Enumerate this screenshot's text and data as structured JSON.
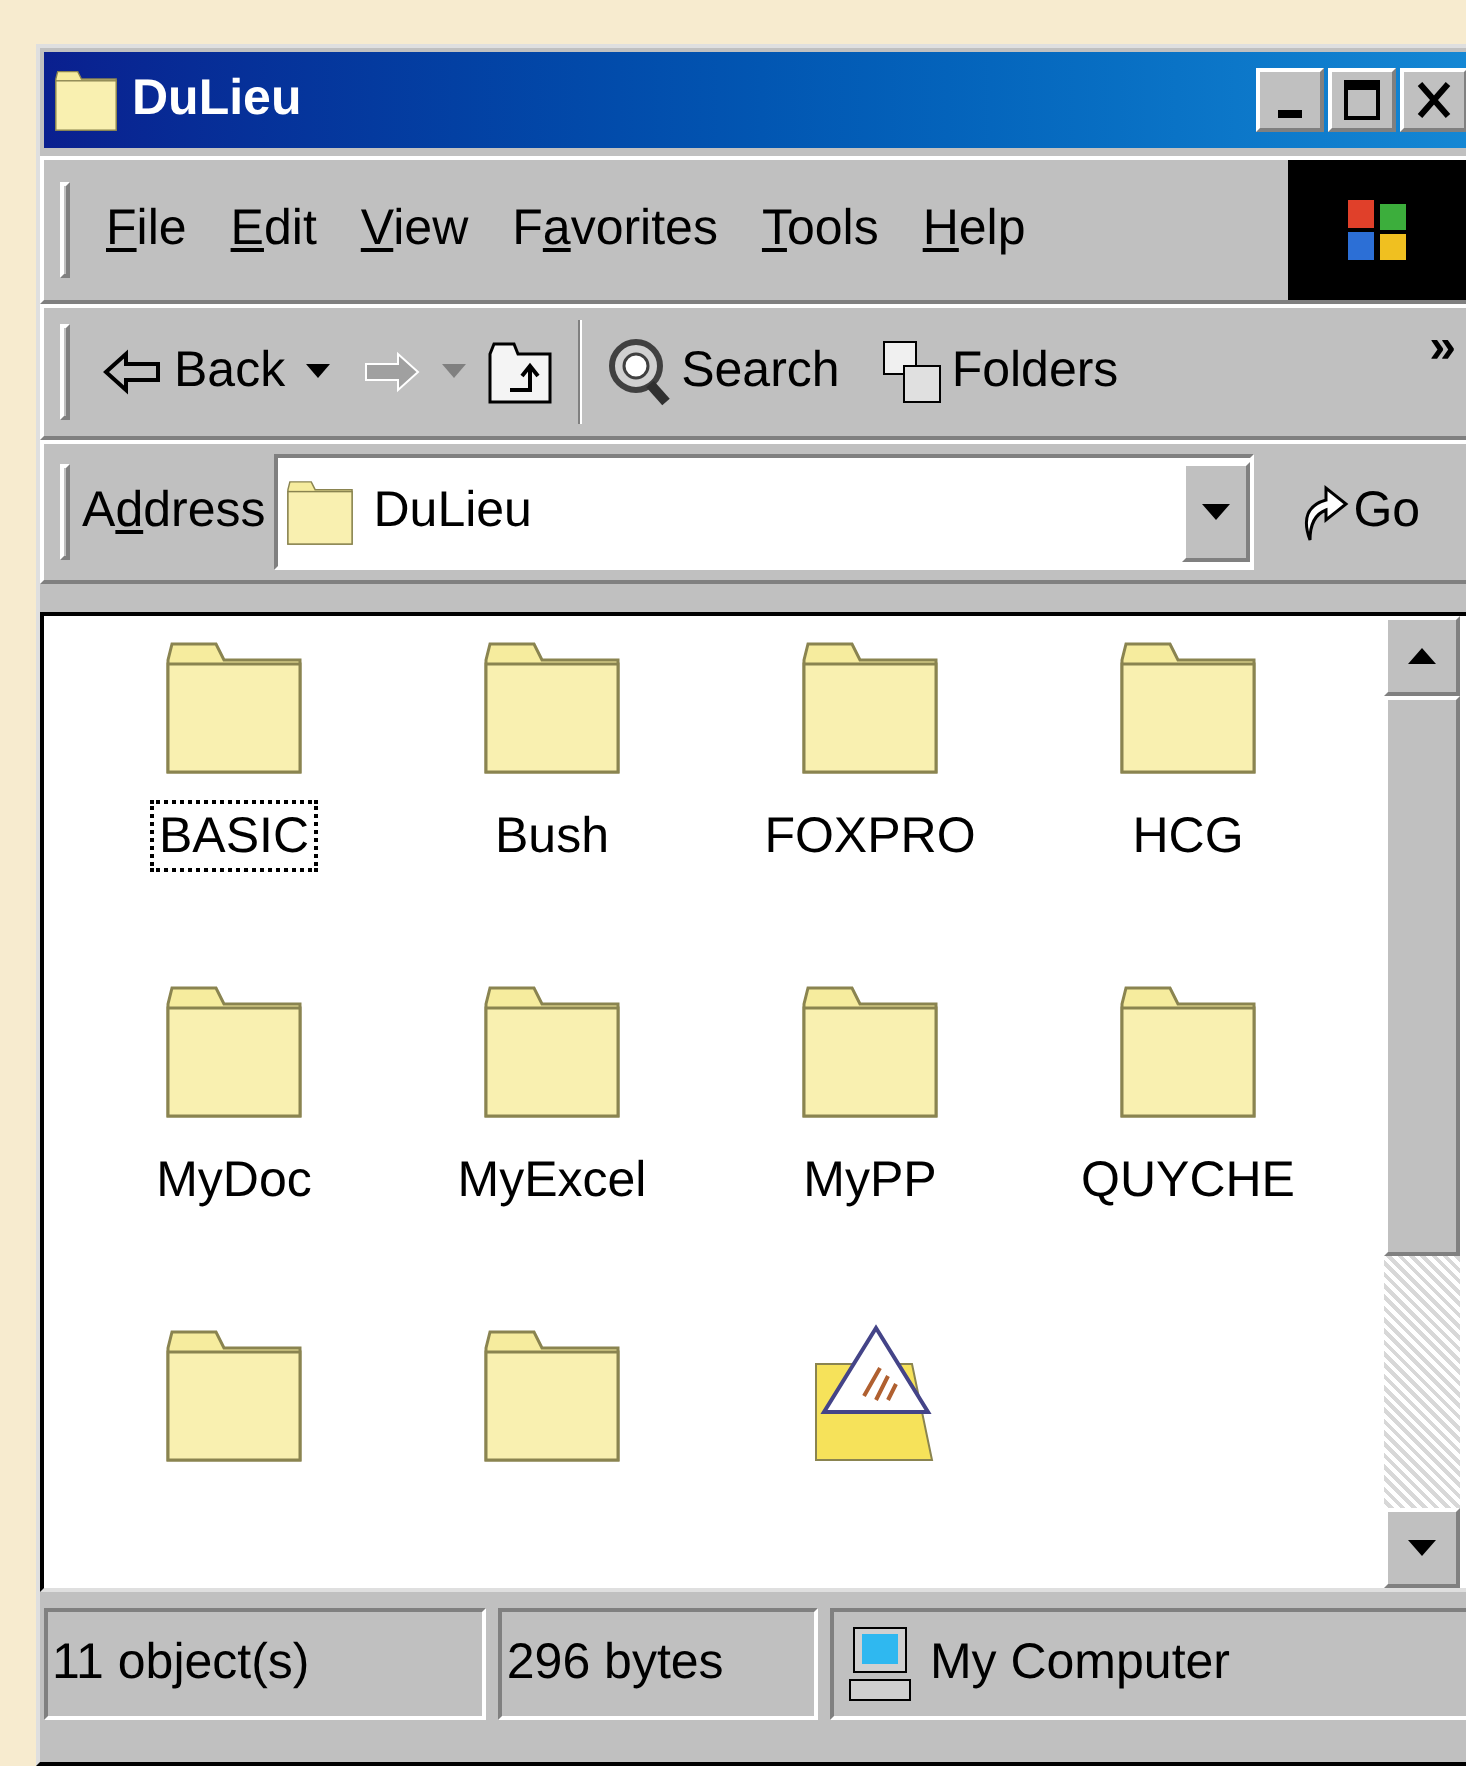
{
  "window": {
    "title": "DuLieu"
  },
  "menu": [
    {
      "key": "F",
      "after": "ile"
    },
    {
      "key": "E",
      "after": "dit"
    },
    {
      "key": "V",
      "after": "iew"
    },
    {
      "before": "F",
      "key": "a",
      "after": "vorites"
    },
    {
      "key": "T",
      "after": "ools"
    },
    {
      "key": "H",
      "after": "elp"
    }
  ],
  "toolbar": {
    "back": "Back",
    "search": "Search",
    "folders": "Folders",
    "more": "»"
  },
  "address": {
    "label": {
      "before": "A",
      "key": "d",
      "after": "dress"
    },
    "value": "DuLieu",
    "go": "Go"
  },
  "items": [
    {
      "kind": "folder",
      "label": "BASIC",
      "focused": true
    },
    {
      "kind": "folder",
      "label": "Bush",
      "focused": false
    },
    {
      "kind": "folder",
      "label": "FOXPRO",
      "focused": false
    },
    {
      "kind": "folder",
      "label": "HCG",
      "focused": false
    },
    {
      "kind": "folder",
      "label": "MyDoc",
      "focused": false
    },
    {
      "kind": "folder",
      "label": "MyExcel",
      "focused": false
    },
    {
      "kind": "folder",
      "label": "MyPP",
      "focused": false
    },
    {
      "kind": "folder",
      "label": "QUYCHE",
      "focused": false
    },
    {
      "kind": "folder",
      "focused": false
    },
    {
      "kind": "folder",
      "focused": false
    },
    {
      "kind": "shared-folder",
      "focused": false
    }
  ],
  "status_bar": [
    "11 object(s)",
    "296 bytes",
    "My Computer"
  ]
}
